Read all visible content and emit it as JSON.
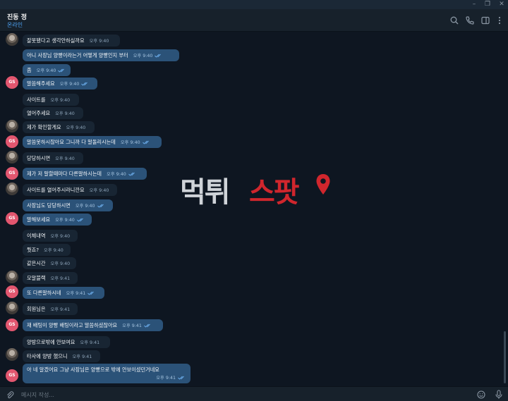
{
  "header": {
    "name": "진동 정",
    "status": "온라인"
  },
  "composer": {
    "placeholder": "메시지 작성..."
  },
  "avatar_gs": "GS",
  "watermark": {
    "part1": "먹튀",
    "part2": "스팟"
  },
  "messages": [
    {
      "text": "잘못됐다고 생각안하실까요",
      "time": "오후 9:40"
    },
    {
      "text": "아니 사장님 양빵이라는거 어떻게 양빵인지 부터",
      "time": "오후 9:40"
    },
    {
      "text": "좀",
      "time": "오후 9:40"
    },
    {
      "text": "말씀해주세요",
      "time": "오후 9:40"
    },
    {
      "text": "사이트를",
      "time": "오후 9:40"
    },
    {
      "text": "열어주세요",
      "time": "오후 9:40"
    },
    {
      "text": "제가 확인할게요",
      "time": "오후 9:40"
    },
    {
      "text": "말씀못하시잖아요 그니까 다 말돌리시는데",
      "time": "오후 9:40"
    },
    {
      "text": "당당하시면",
      "time": "오후 9:40"
    },
    {
      "text": "제가 저 말할때마다 다른말하시는데",
      "time": "오후 9:40"
    },
    {
      "text": "사이트를 열어주시라니깐요",
      "time": "오후 9:40"
    },
    {
      "text": "사장님도 당당하시면",
      "time": "오후 9:40"
    },
    {
      "text": "말해보세요",
      "time": "오후 9:40"
    },
    {
      "text": "이체내역",
      "time": "오후 9:40"
    },
    {
      "text": "뭣죠?",
      "time": "오후 9:40"
    },
    {
      "text": "같은시간",
      "time": "오후 9:40"
    },
    {
      "text": "모알블랙",
      "time": "오후 9:41"
    },
    {
      "text": "또 다른말하시네",
      "time": "오후 9:41"
    },
    {
      "text": "회원님은",
      "time": "오후 9:41"
    },
    {
      "text": "재 배팅이 양빵 배팅이라고 말씀하셨잖아요",
      "time": "오후 9:41"
    },
    {
      "text": "양방으로밖에 안보여요",
      "time": "오후 9:41"
    },
    {
      "text": "타사에 양방 했으니",
      "time": "오후 9:41"
    },
    {
      "text": "아 네 알겠어요 그냥 사장님은 양빵으로 밖에 안보이셨던거네요",
      "time": "오후 9:41"
    }
  ]
}
